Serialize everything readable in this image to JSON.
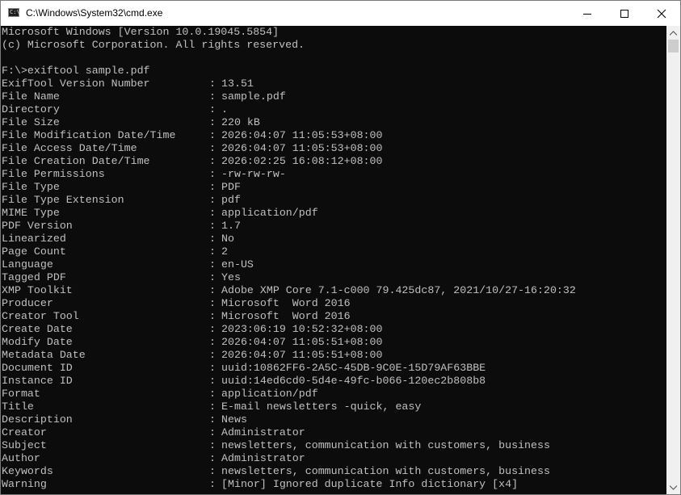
{
  "window": {
    "title": "C:\\Windows\\System32\\cmd.exe",
    "icon": "cmd-icon",
    "controls": [
      "minimize-icon",
      "maximize-icon",
      "close-icon"
    ]
  },
  "terminal": {
    "colors": {
      "background": "#0c0c0c",
      "text": "#c0c0c0"
    },
    "header": [
      "Microsoft Windows [Version 10.0.19045.5854]",
      "(c) Microsoft Corporation. All rights reserved."
    ],
    "command": "F:\\>exiftool sample.pdf",
    "separator": ":",
    "rows": [
      {
        "key": "ExifTool Version Number",
        "value": "13.51"
      },
      {
        "key": "File Name",
        "value": "sample.pdf"
      },
      {
        "key": "Directory",
        "value": "."
      },
      {
        "key": "File Size",
        "value": "220 kB"
      },
      {
        "key": "File Modification Date/Time",
        "value": "2026:04:07 11:05:53+08:00"
      },
      {
        "key": "File Access Date/Time",
        "value": "2026:04:07 11:05:53+08:00"
      },
      {
        "key": "File Creation Date/Time",
        "value": "2026:02:25 16:08:12+08:00"
      },
      {
        "key": "File Permissions",
        "value": "-rw-rw-rw-"
      },
      {
        "key": "File Type",
        "value": "PDF"
      },
      {
        "key": "File Type Extension",
        "value": "pdf"
      },
      {
        "key": "MIME Type",
        "value": "application/pdf"
      },
      {
        "key": "PDF Version",
        "value": "1.7"
      },
      {
        "key": "Linearized",
        "value": "No"
      },
      {
        "key": "Page Count",
        "value": "2"
      },
      {
        "key": "Language",
        "value": "en-US"
      },
      {
        "key": "Tagged PDF",
        "value": "Yes"
      },
      {
        "key": "XMP Toolkit",
        "value": "Adobe XMP Core 7.1-c000 79.425dc87, 2021/10/27-16:20:32"
      },
      {
        "key": "Producer",
        "value": "Microsoft  Word 2016"
      },
      {
        "key": "Creator Tool",
        "value": "Microsoft  Word 2016"
      },
      {
        "key": "Create Date",
        "value": "2023:06:19 10:52:32+08:00"
      },
      {
        "key": "Modify Date",
        "value": "2026:04:07 11:05:51+08:00"
      },
      {
        "key": "Metadata Date",
        "value": "2026:04:07 11:05:51+08:00"
      },
      {
        "key": "Document ID",
        "value": "uuid:10862FF6-2A5C-45DB-9C0E-15D79AF63BBE"
      },
      {
        "key": "Instance ID",
        "value": "uuid:14ed6cd0-5d4e-49fc-b066-120ec2b808b8"
      },
      {
        "key": "Format",
        "value": "application/pdf"
      },
      {
        "key": "Title",
        "value": "E-mail newsletters -quick, easy"
      },
      {
        "key": "Description",
        "value": "News"
      },
      {
        "key": "Creator",
        "value": "Administrator"
      },
      {
        "key": "Subject",
        "value": "newsletters, communication with customers, business"
      },
      {
        "key": "Author",
        "value": "Administrator"
      },
      {
        "key": "Keywords",
        "value": "newsletters, communication with customers, business"
      },
      {
        "key": "Warning",
        "value": "[Minor] Ignored duplicate Info dictionary [x4]"
      }
    ]
  },
  "scrollbar": {
    "up_icon": "scroll-up-arrow-icon",
    "down_icon": "scroll-down-arrow-icon"
  }
}
